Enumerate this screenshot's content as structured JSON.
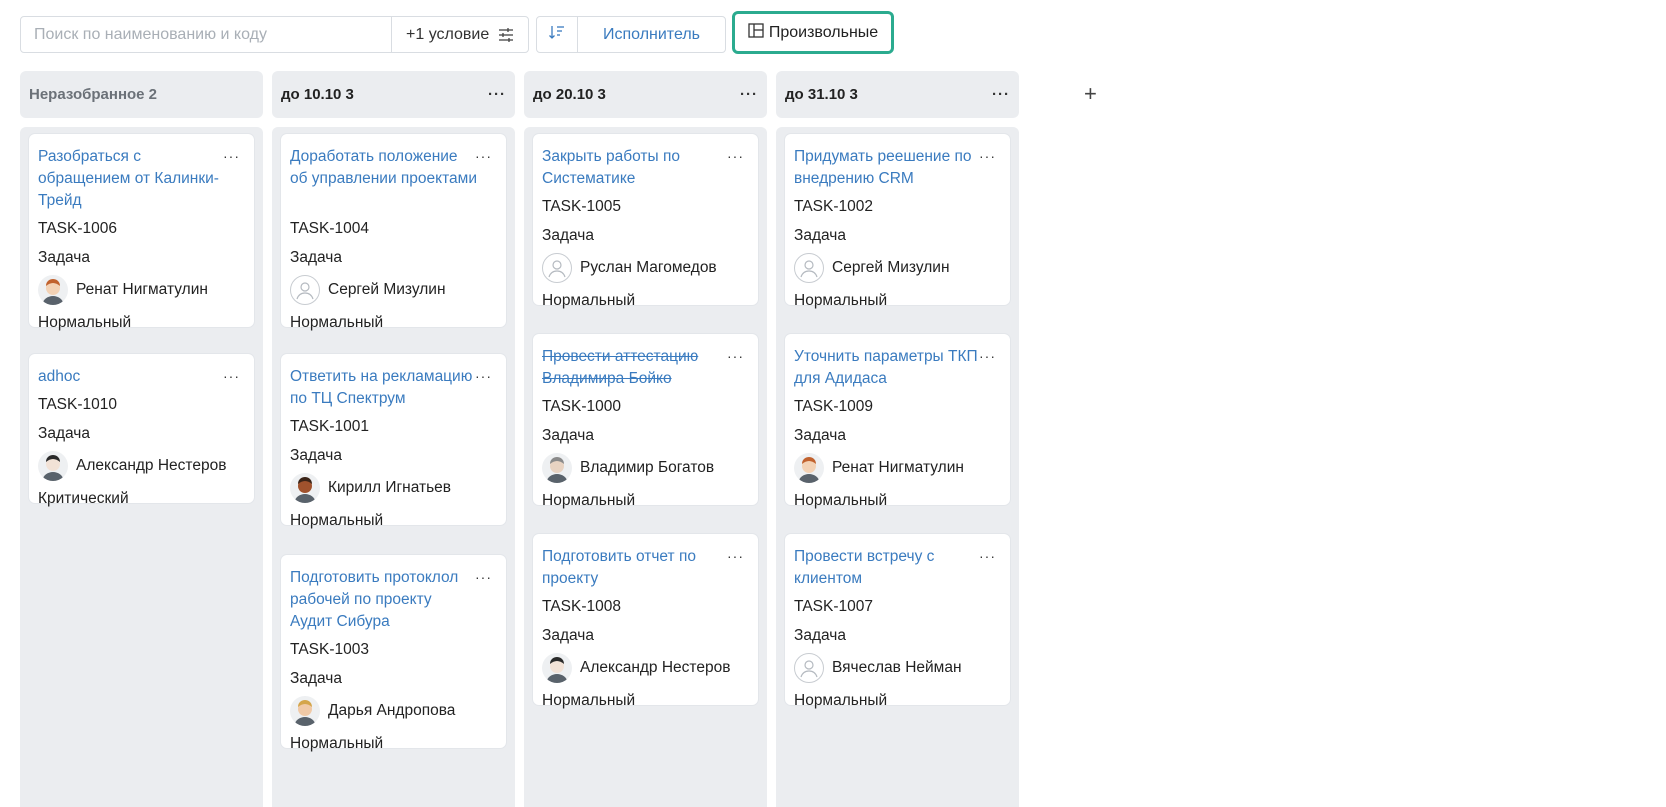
{
  "toolbar": {
    "search_placeholder": "Поиск по наименованию и коду",
    "condition_label": "+1 условие",
    "assignee_label": "Исполнитель",
    "custom_label": "Произвольные",
    "accent_color": "#2bab8f",
    "link_color": "#3a7bbf"
  },
  "columns": [
    {
      "title": "Неразобранное 2",
      "cards": [
        {
          "title": "Разобраться с обращением от Калинки-Трейд",
          "code": "TASK-1006",
          "type": "Задача",
          "assignee": "Ренат Нигматулин",
          "avatar": "photo-red-hair",
          "priority": "Нормальный"
        },
        {
          "title": "adhoc",
          "code": "TASK-1010",
          "type": "Задача",
          "assignee": "Александр Нестеров",
          "avatar": "photo-glasses",
          "priority": "Критический"
        }
      ]
    },
    {
      "title": "до 10.10 3",
      "cards": [
        {
          "title": "Доработать положение об управлении проектами",
          "code": "TASK-1004",
          "type": "Задача",
          "assignee": "Сергей Мизулин",
          "avatar": "placeholder",
          "priority": "Нормальный"
        },
        {
          "title": "Ответить на рекламацию по ТЦ Спектрум",
          "code": "TASK-1001",
          "type": "Задача",
          "assignee": "Кирилл Игнатьев",
          "avatar": "photo-dark",
          "priority": "Нормальный"
        },
        {
          "title": "Подготовить протоклол рабочей по проекту Аудит Сибура",
          "code": "TASK-1003",
          "type": "Задача",
          "assignee": "Дарья Андропова",
          "avatar": "photo-blonde",
          "priority": "Нормальный"
        }
      ]
    },
    {
      "title": "до 20.10 3",
      "cards": [
        {
          "title": "Закрыть работы по Систематике",
          "code": "TASK-1005",
          "type": "Задача",
          "assignee": "Руслан Магомедов",
          "avatar": "placeholder",
          "priority": "Нормальный"
        },
        {
          "title": "Провести аттестацию Владимира Бойко",
          "code": "TASK-1000",
          "type": "Задача",
          "assignee": "Владимир Богатов",
          "avatar": "photo-grey",
          "priority": "Нормальный",
          "done": true
        },
        {
          "title": "Подготовить отчет по проекту",
          "code": "TASK-1008",
          "type": "Задача",
          "assignee": "Александр Нестеров",
          "avatar": "photo-glasses",
          "priority": "Нормальный"
        }
      ]
    },
    {
      "title": "до 31.10 3",
      "cards": [
        {
          "title": "Придумать реешение по внедрению CRM",
          "code": "TASK-1002",
          "type": "Задача",
          "assignee": "Сергей Мизулин",
          "avatar": "placeholder",
          "priority": "Нормальный"
        },
        {
          "title": "Уточнить параметры ТКП для Адидаса",
          "code": "TASK-1009",
          "type": "Задача",
          "assignee": "Ренат Нигматулин",
          "avatar": "photo-red-hair",
          "priority": "Нормальный"
        },
        {
          "title": "Провести встречу с клиентом",
          "code": "TASK-1007",
          "type": "Задача",
          "assignee": "Вячеслав Нейман",
          "avatar": "placeholder",
          "priority": "Нормальный"
        }
      ]
    }
  ],
  "add_column_label": "+"
}
